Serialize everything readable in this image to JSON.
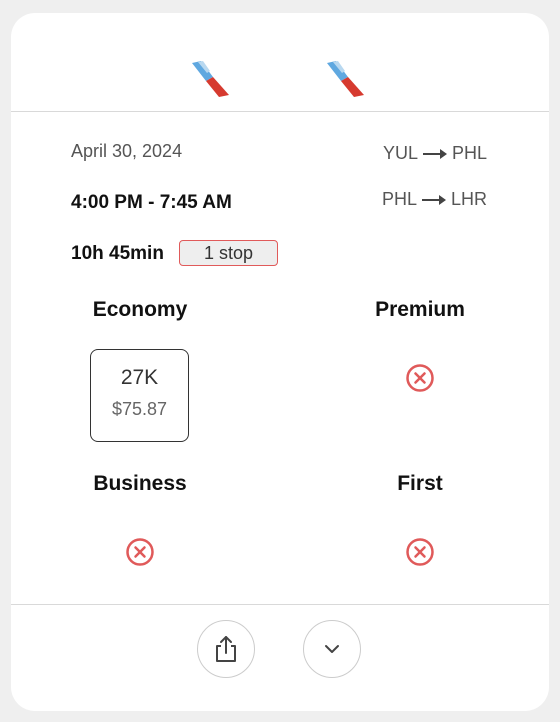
{
  "flight": {
    "date": "April 30, 2024",
    "time_range": "4:00 PM - 7:45 AM",
    "duration": "10h 45min",
    "stops": "1 stop",
    "segments": [
      {
        "from": "YUL",
        "to": "PHL"
      },
      {
        "from": "PHL",
        "to": "LHR"
      }
    ]
  },
  "airline_logos": [
    "american-airlines-logo",
    "american-airlines-logo"
  ],
  "cabins": {
    "economy": {
      "label": "Economy",
      "points": "27K",
      "price": "$75.87",
      "available": true
    },
    "premium": {
      "label": "Premium",
      "available": false
    },
    "business": {
      "label": "Business",
      "available": false
    },
    "first": {
      "label": "First",
      "available": false
    }
  },
  "actions": {
    "share_icon": "share-icon",
    "expand_icon": "chevron-down-icon"
  },
  "colors": {
    "unavailable_red": "#e05a5a",
    "logo_blue": "#5fa8e0",
    "logo_red": "#d63a2f"
  }
}
